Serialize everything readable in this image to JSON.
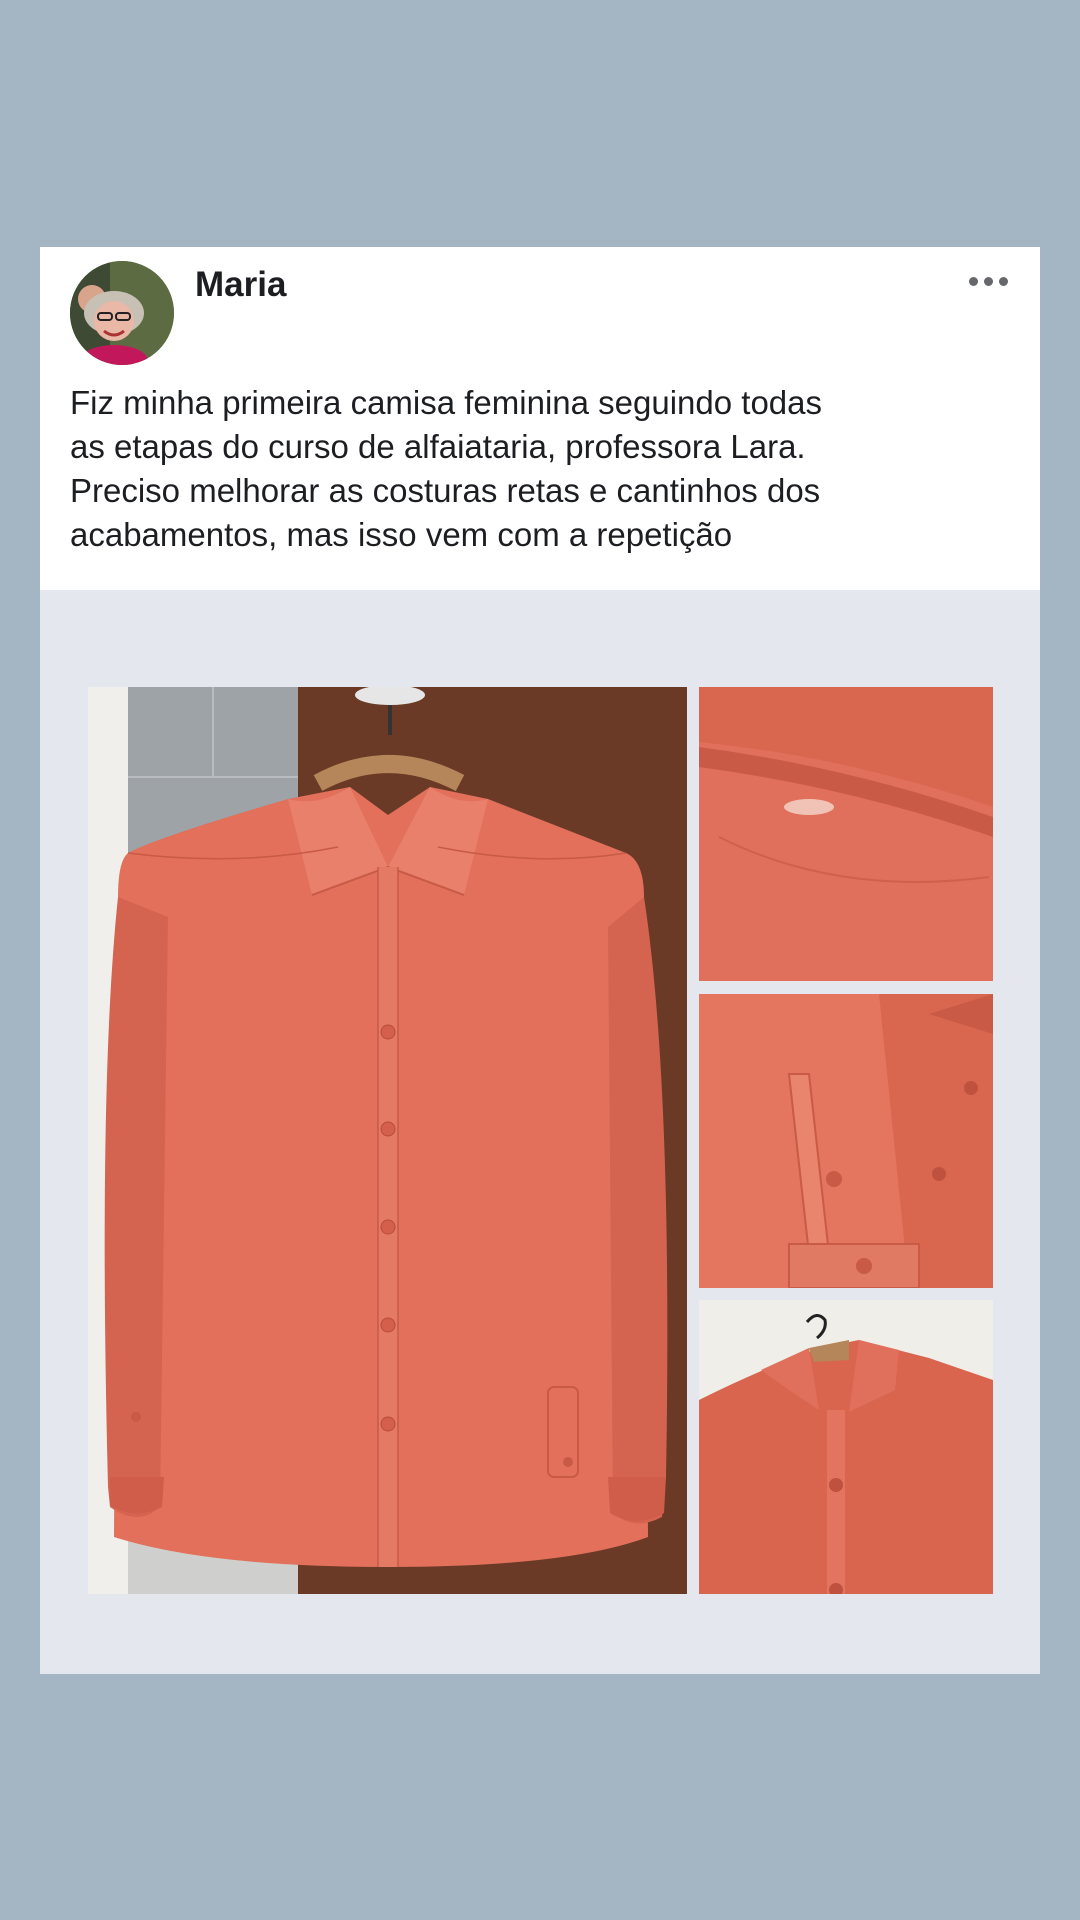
{
  "post": {
    "author": "Maria",
    "text_lines": [
      "Fiz minha primeira camisa feminina seguindo todas",
      "as etapas do curso de alfaiataria, professora Lara.",
      "Preciso melhorar as costuras retas e cantinhos dos",
      "acabamentos, mas isso vem com a repetição"
    ],
    "more_icon": "more-horizontal-icon"
  },
  "colors": {
    "page_background": "#a4b5c4",
    "card_background": "#e4e7ee",
    "shirt": "#e2705b",
    "door": "#6a3a26"
  }
}
